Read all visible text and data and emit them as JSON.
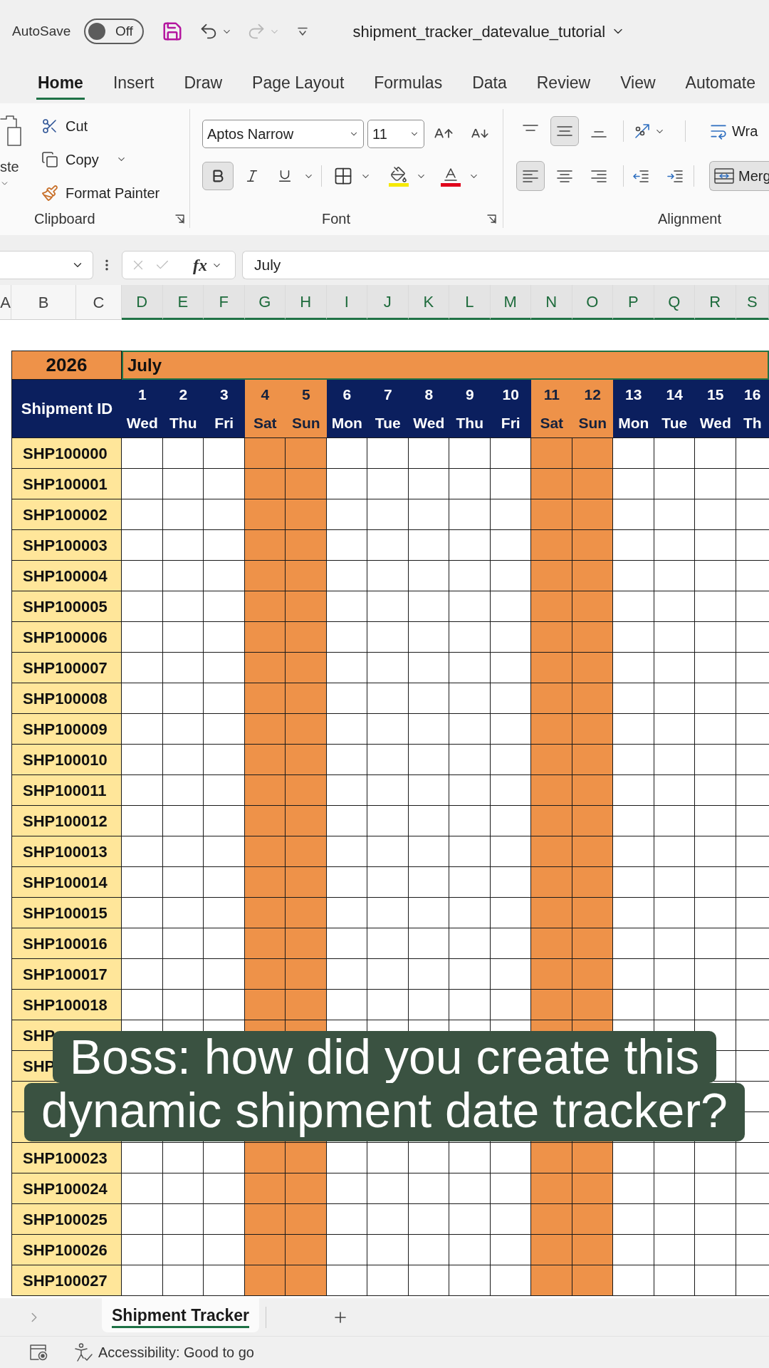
{
  "title_bar": {
    "autosave_label": "AutoSave",
    "autosave": {
      "on": false,
      "label": "Off"
    },
    "file_name": "shipment_tracker_datevalue_tutorial"
  },
  "ribbon_tabs": [
    {
      "label": "Home",
      "selected": true
    },
    {
      "label": "Insert",
      "selected": false
    },
    {
      "label": "Draw",
      "selected": false
    },
    {
      "label": "Page Layout",
      "selected": false
    },
    {
      "label": "Formulas",
      "selected": false
    },
    {
      "label": "Data",
      "selected": false
    },
    {
      "label": "Review",
      "selected": false
    },
    {
      "label": "View",
      "selected": false
    },
    {
      "label": "Automate",
      "selected": false
    }
  ],
  "ribbon": {
    "clipboard": {
      "paste_label": "ste",
      "commands": [
        {
          "kind": "cut",
          "label": "Cut"
        },
        {
          "kind": "copy",
          "label": "Copy"
        },
        {
          "kind": "format_painter",
          "label": "Format Painter"
        }
      ],
      "group_label": "Clipboard"
    },
    "font": {
      "font_name": "Aptos Narrow",
      "font_size": "11",
      "bold": true,
      "italic": false,
      "underline": false,
      "group_label": "Font"
    },
    "alignment": {
      "vertical": [
        {
          "kind": "top",
          "selected": false
        },
        {
          "kind": "middle",
          "selected": true
        },
        {
          "kind": "bottom",
          "selected": false
        }
      ],
      "horizontal": [
        {
          "kind": "left",
          "selected": true
        },
        {
          "kind": "center",
          "selected": false
        },
        {
          "kind": "right",
          "selected": false
        }
      ],
      "wrap_text": {
        "label": "Wra",
        "on": false
      },
      "merge": {
        "label": "Merg",
        "on": true
      },
      "group_label": "Alignment"
    }
  },
  "formula_bar": {
    "function_label": "fx",
    "value": "July"
  },
  "column_headers": [
    {
      "label": "A",
      "selected": false
    },
    {
      "label": "B",
      "selected": false
    },
    {
      "label": "C",
      "selected": false
    },
    {
      "label": "D",
      "selected": true
    },
    {
      "label": "E",
      "selected": true
    },
    {
      "label": "F",
      "selected": true
    },
    {
      "label": "G",
      "selected": true
    },
    {
      "label": "H",
      "selected": true
    },
    {
      "label": "I",
      "selected": true
    },
    {
      "label": "J",
      "selected": true
    },
    {
      "label": "K",
      "selected": true
    },
    {
      "label": "L",
      "selected": true
    },
    {
      "label": "M",
      "selected": true
    },
    {
      "label": "N",
      "selected": true
    },
    {
      "label": "O",
      "selected": true
    },
    {
      "label": "P",
      "selected": true
    },
    {
      "label": "Q",
      "selected": true
    },
    {
      "label": "R",
      "selected": true
    },
    {
      "label": "S",
      "selected": true
    }
  ],
  "sheet": {
    "year": "2026",
    "month": {
      "label": "July",
      "selected": true
    },
    "id_header": "Shipment ID",
    "days": [
      {
        "day": "1",
        "weekday": "Wed",
        "weekend": false
      },
      {
        "day": "2",
        "weekday": "Thu",
        "weekend": false
      },
      {
        "day": "3",
        "weekday": "Fri",
        "weekend": false
      },
      {
        "day": "4",
        "weekday": "Sat",
        "weekend": true
      },
      {
        "day": "5",
        "weekday": "Sun",
        "weekend": true
      },
      {
        "day": "6",
        "weekday": "Mon",
        "weekend": false
      },
      {
        "day": "7",
        "weekday": "Tue",
        "weekend": false
      },
      {
        "day": "8",
        "weekday": "Wed",
        "weekend": false
      },
      {
        "day": "9",
        "weekday": "Thu",
        "weekend": false
      },
      {
        "day": "10",
        "weekday": "Fri",
        "weekend": false
      },
      {
        "day": "11",
        "weekday": "Sat",
        "weekend": true
      },
      {
        "day": "12",
        "weekday": "Sun",
        "weekend": true
      },
      {
        "day": "13",
        "weekday": "Mon",
        "weekend": false
      },
      {
        "day": "14",
        "weekday": "Tue",
        "weekend": false
      },
      {
        "day": "15",
        "weekday": "Wed",
        "weekend": false
      },
      {
        "day": "16",
        "weekday": "Th",
        "weekend": false
      }
    ],
    "rows": [
      {
        "id": "SHP100000"
      },
      {
        "id": "SHP100001"
      },
      {
        "id": "SHP100002"
      },
      {
        "id": "SHP100003"
      },
      {
        "id": "SHP100004"
      },
      {
        "id": "SHP100005"
      },
      {
        "id": "SHP100006"
      },
      {
        "id": "SHP100007"
      },
      {
        "id": "SHP100008"
      },
      {
        "id": "SHP100009"
      },
      {
        "id": "SHP100010"
      },
      {
        "id": "SHP100011"
      },
      {
        "id": "SHP100012"
      },
      {
        "id": "SHP100013"
      },
      {
        "id": "SHP100014"
      },
      {
        "id": "SHP100015"
      },
      {
        "id": "SHP100016"
      },
      {
        "id": "SHP100017"
      },
      {
        "id": "SHP100018"
      },
      {
        "id": "SHP"
      },
      {
        "id": "SHP"
      },
      {},
      {},
      {
        "id": "SHP100023"
      },
      {
        "id": "SHP100024"
      },
      {
        "id": "SHP100025"
      },
      {
        "id": "SHP100026"
      },
      {
        "id": "SHP100027"
      }
    ]
  },
  "caption": [
    "Boss: how did you create this",
    "dynamic shipment date tracker?"
  ],
  "sheet_tabs": [
    {
      "label": "Shipment Tracker",
      "selected": true
    }
  ],
  "status_bar": {
    "accessibility": "Accessibility: Good to go"
  }
}
